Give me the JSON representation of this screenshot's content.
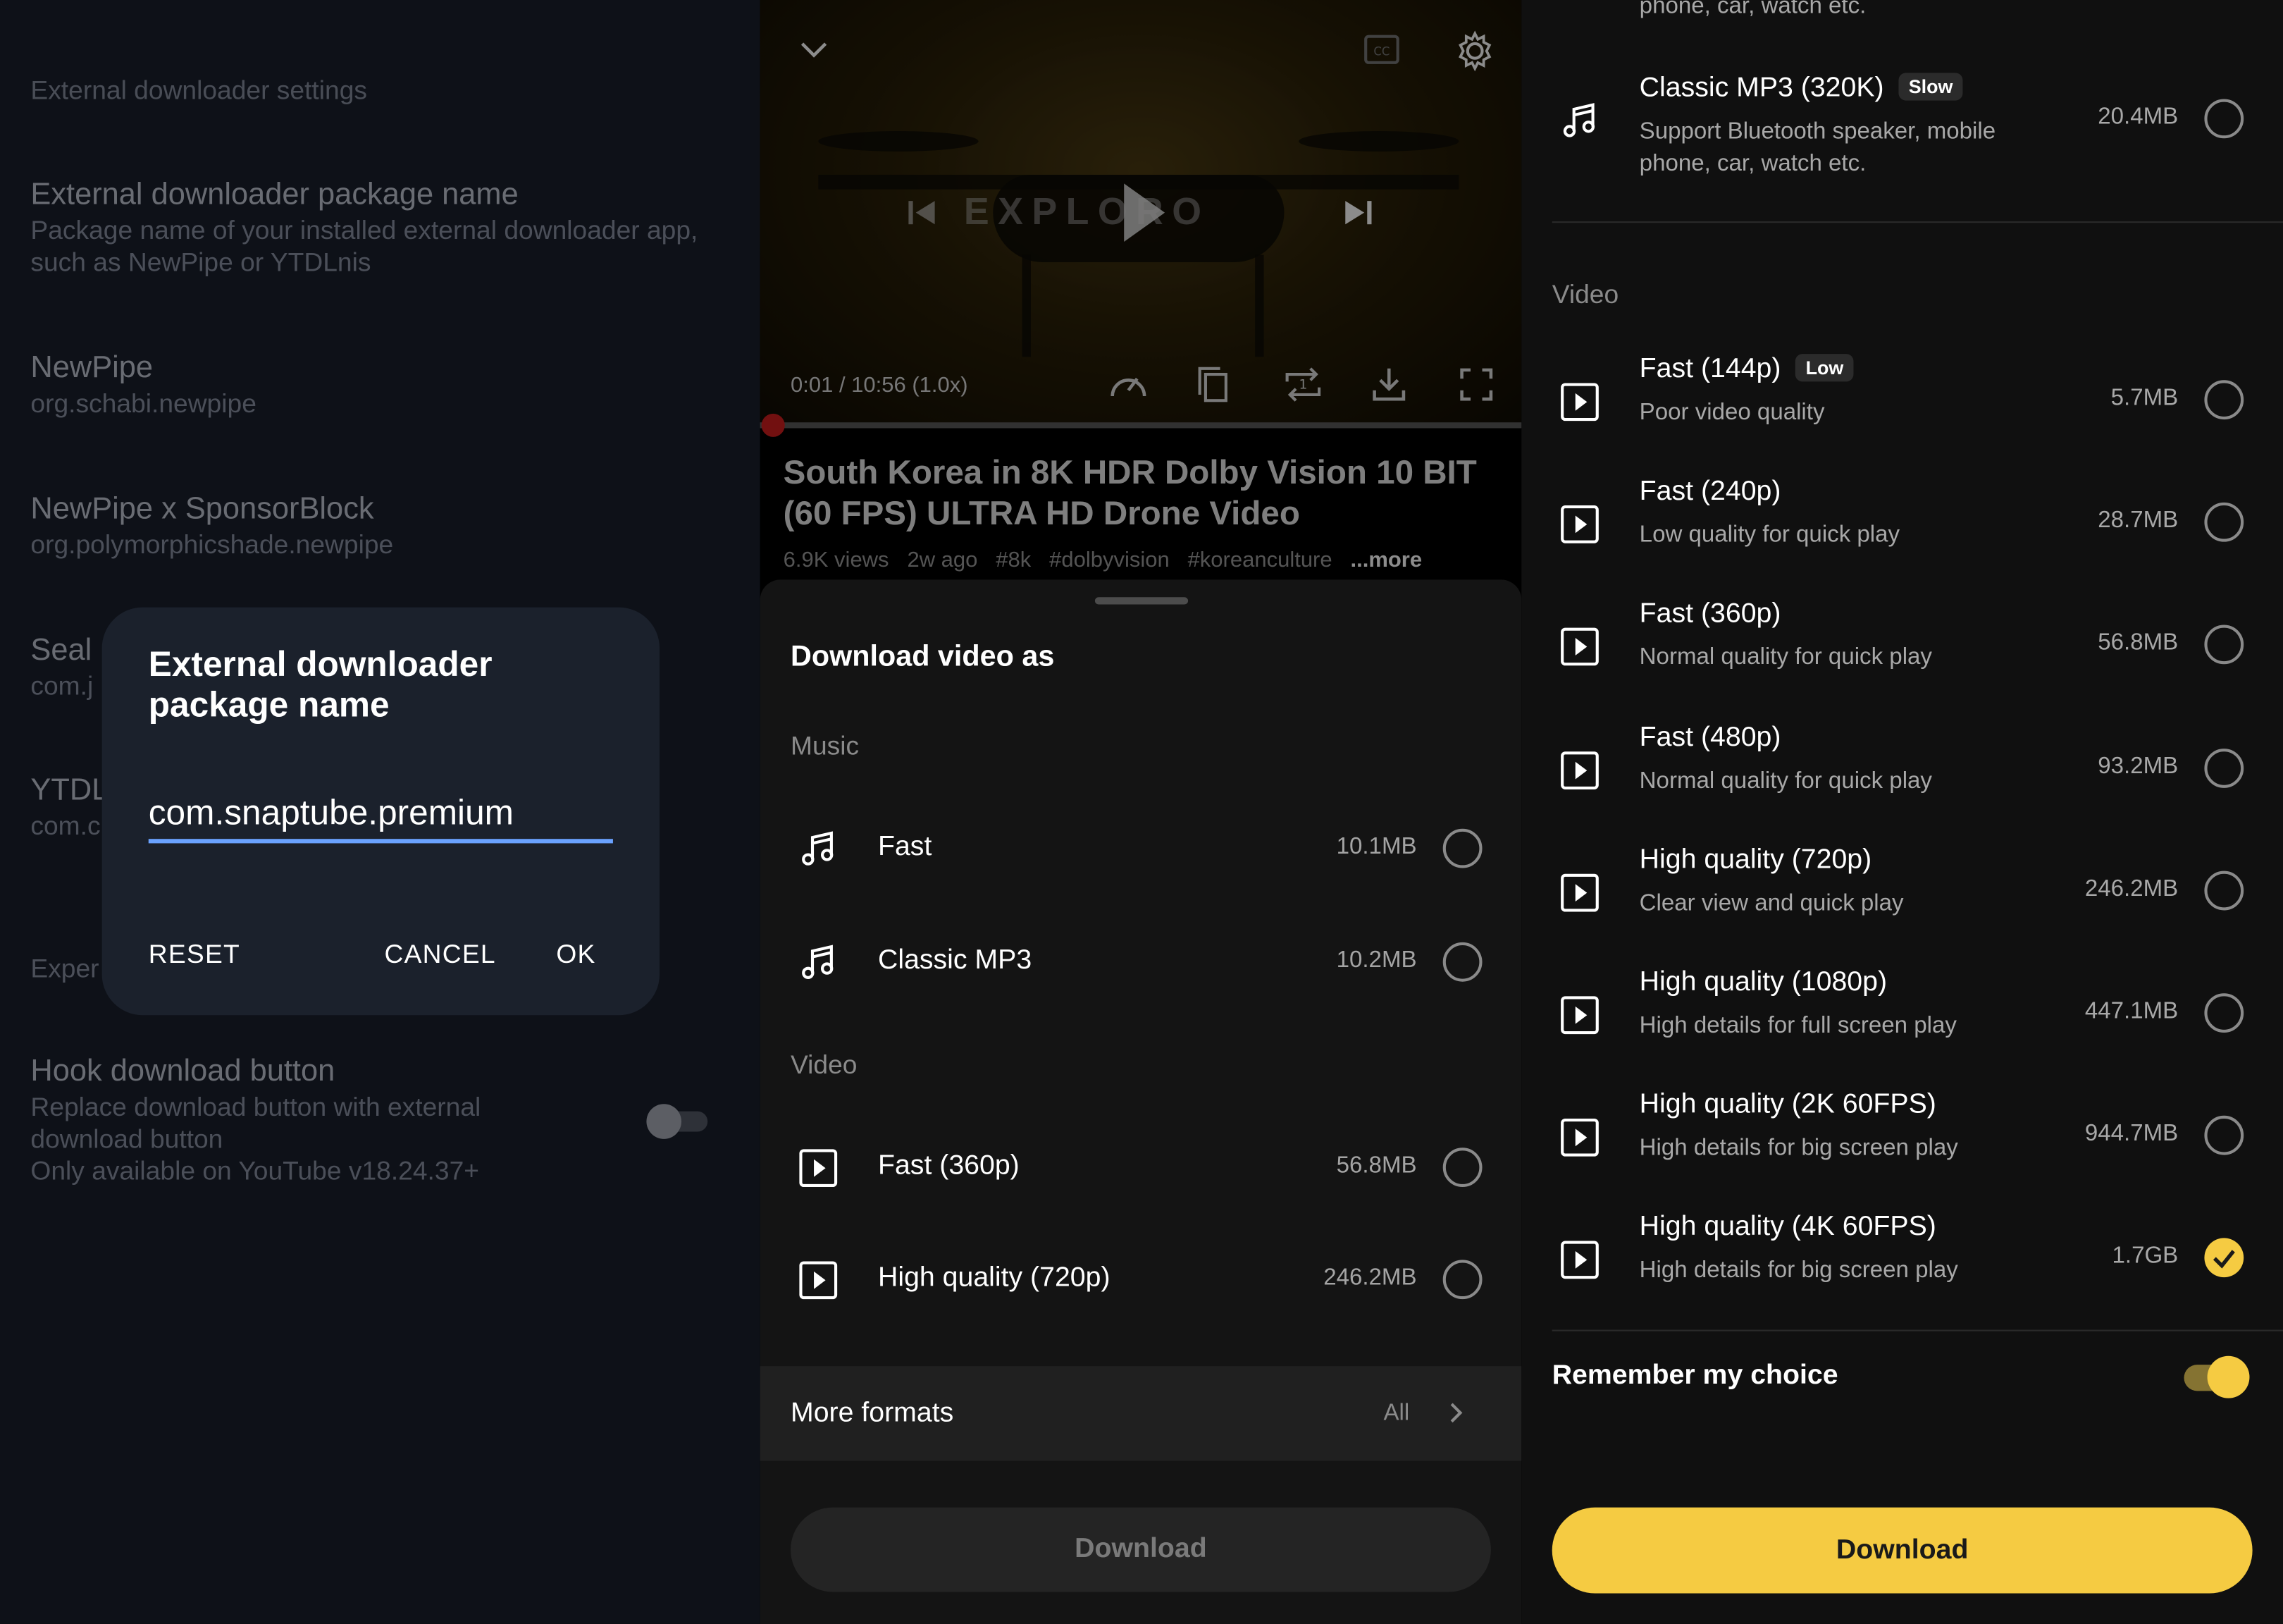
{
  "settings": {
    "header": "External downloader settings",
    "items": [
      {
        "title": "External downloader package name",
        "subtitle": "Package name of your installed external downloader app, such as NewPipe or YTDLnis"
      },
      {
        "title": "NewPipe",
        "subtitle": "org.schabi.newpipe"
      },
      {
        "title": "NewPipe x SponsorBlock",
        "subtitle": "org.polymorphicshade.newpipe"
      },
      {
        "title": "Seal",
        "subtitle": "com.j"
      },
      {
        "title": "YTDL",
        "subtitle": "com.c"
      },
      {
        "title": "Exper",
        "subtitle": ""
      },
      {
        "title": "Hook download button",
        "subtitle": "Replace download button with external download button",
        "note": "Only available on YouTube v18.24.37+"
      }
    ],
    "hook_toggle_on": false
  },
  "dialog": {
    "title": "External downloader package name",
    "value": "com.snaptube.premium",
    "reset": "RESET",
    "cancel": "CANCEL",
    "ok": "OK"
  },
  "player": {
    "time": "0:01 / 10:56 (1.0x)",
    "watermark": "EXPLORO",
    "progress": 0.0015,
    "title": "South Korea in 8K HDR Dolby Vision 10 BIT (60 FPS) ULTRA HD Drone Video",
    "views": "6.9K views",
    "age": "2w ago",
    "tags": [
      "#8k",
      "#dolbyvision",
      "#koreanculture"
    ],
    "more": "...more"
  },
  "sheet": {
    "title": "Download video as",
    "music_label": "Music",
    "music": [
      {
        "label": "Fast",
        "size": "10.1MB"
      },
      {
        "label": "Classic MP3",
        "size": "10.2MB"
      }
    ],
    "video_label": "Video",
    "video": [
      {
        "label": "Fast (360p)",
        "size": "56.8MB"
      },
      {
        "label": "High quality (720p)",
        "size": "246.2MB"
      }
    ],
    "more_formats": "More formats",
    "more_formats_value": "All",
    "download": "Download"
  },
  "formats": {
    "top_cut_text": "phone, car, watch etc.",
    "mp3": {
      "title": "Classic MP3 (320K)",
      "badge": "Slow",
      "subtitle": "Support Bluetooth speaker, mobile phone, car, watch etc.",
      "size": "20.4MB"
    },
    "video_label": "Video",
    "video": [
      {
        "title": "Fast (144p)",
        "badge": "Low",
        "subtitle": "Poor video quality",
        "size": "5.7MB",
        "checked": false
      },
      {
        "title": "Fast (240p)",
        "badge": "",
        "subtitle": "Low quality for quick play",
        "size": "28.7MB",
        "checked": false
      },
      {
        "title": "Fast (360p)",
        "badge": "",
        "subtitle": "Normal quality for quick play",
        "size": "56.8MB",
        "checked": false
      },
      {
        "title": "Fast (480p)",
        "badge": "",
        "subtitle": "Normal quality for quick play",
        "size": "93.2MB",
        "checked": false
      },
      {
        "title": "High quality (720p)",
        "badge": "",
        "subtitle": "Clear view and quick play",
        "size": "246.2MB",
        "checked": false
      },
      {
        "title": "High quality (1080p)",
        "badge": "",
        "subtitle": "High details for full screen play",
        "size": "447.1MB",
        "checked": false
      },
      {
        "title": "High quality (2K 60FPS)",
        "badge": "",
        "subtitle": "High details for big screen play",
        "size": "944.7MB",
        "checked": false
      },
      {
        "title": "High quality (4K 60FPS)",
        "badge": "",
        "subtitle": "High details for big screen play",
        "size": "1.7GB",
        "checked": true
      }
    ],
    "remember": "Remember my choice",
    "remember_on": true,
    "download": "Download"
  },
  "colors": {
    "accent_yellow": "#f5cb42",
    "input_underline": "#6aa2ff",
    "progress_red": "#d01e1e"
  },
  "icons": [
    "chevron-down-icon",
    "captions-icon",
    "gear-icon",
    "play-icon",
    "skip-previous-icon",
    "skip-next-icon",
    "speed-icon",
    "copy-icon",
    "repeat-icon",
    "download-icon",
    "fullscreen-icon",
    "music-note-icon",
    "video-play-icon",
    "chevron-right-icon",
    "check-icon"
  ]
}
